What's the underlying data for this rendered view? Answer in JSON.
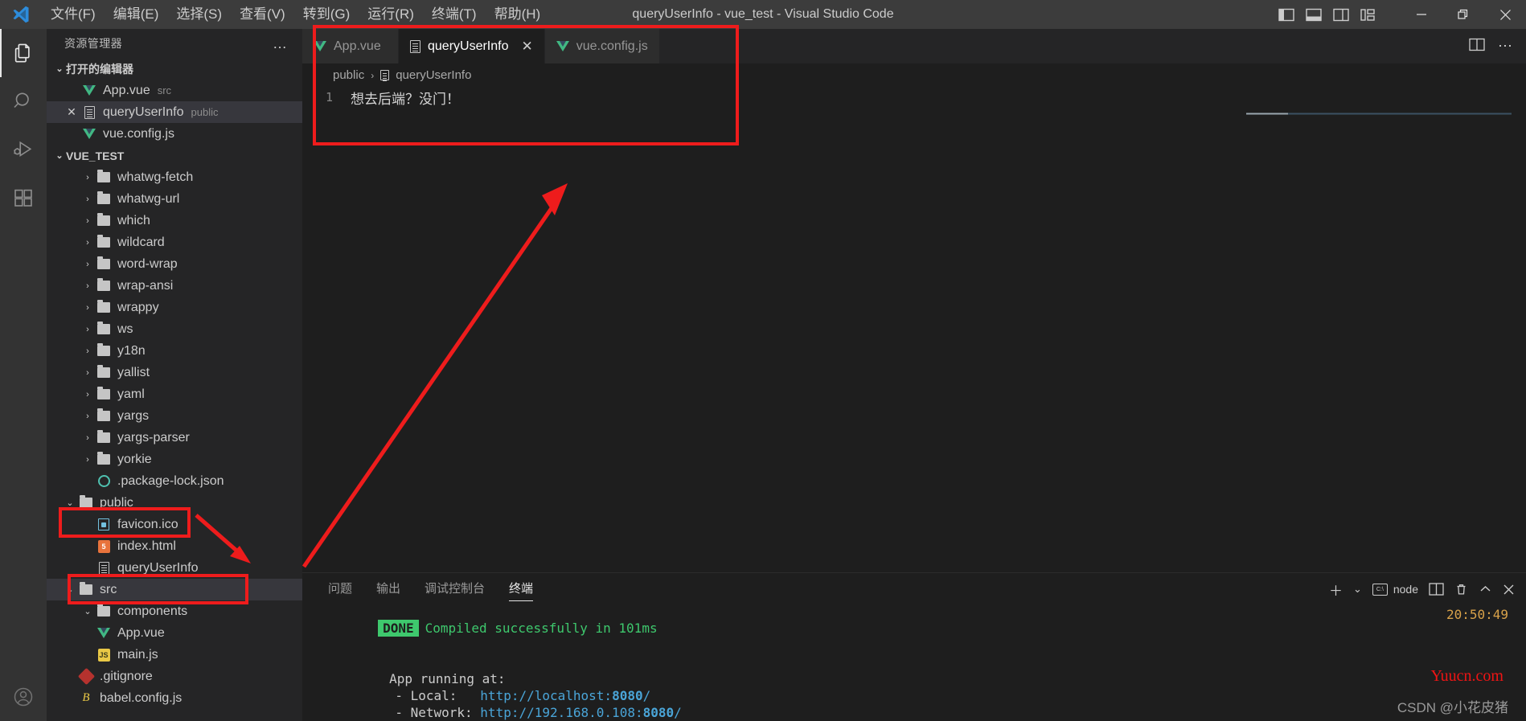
{
  "window": {
    "title": "queryUserInfo - vue_test - Visual Studio Code",
    "menus": [
      "文件(F)",
      "编辑(E)",
      "选择(S)",
      "查看(V)",
      "转到(G)",
      "运行(R)",
      "终端(T)",
      "帮助(H)"
    ],
    "layout_icons": [
      "toggle-primary-sidebar-icon",
      "toggle-panel-icon",
      "toggle-secondary-sidebar-icon",
      "customize-layout-icon"
    ],
    "win_buttons": {
      "minimize": "—",
      "restore": "❐",
      "close": "✕"
    }
  },
  "activitybar": {
    "items": [
      {
        "name": "explorer",
        "icon": "files-icon",
        "active": true
      },
      {
        "name": "search",
        "icon": "search-icon",
        "active": false
      },
      {
        "name": "run-and-debug",
        "icon": "run-debug-icon",
        "active": false
      },
      {
        "name": "extensions",
        "icon": "extensions-icon",
        "active": false
      }
    ],
    "bottom": [
      {
        "name": "accounts",
        "icon": "account-icon"
      }
    ]
  },
  "sidebar": {
    "header": "资源管理器",
    "more_label": "…",
    "open_editors": {
      "label": "打开的编辑器",
      "expanded": true,
      "items": [
        {
          "name": "App.vue",
          "desc": "src",
          "icon": "vue-icon",
          "selected": false,
          "has_close": false
        },
        {
          "name": "queryUserInfo",
          "desc": "public",
          "icon": "file-icon",
          "selected": true,
          "has_close": true
        },
        {
          "name": "vue.config.js",
          "desc": "",
          "icon": "vue-icon",
          "selected": false,
          "has_close": false
        }
      ]
    },
    "project": {
      "label": "VUE_TEST",
      "expanded": true,
      "items": [
        {
          "name": "whatwg-fetch",
          "type": "folder",
          "indent": 1,
          "expanded": false
        },
        {
          "name": "whatwg-url",
          "type": "folder",
          "indent": 1,
          "expanded": false
        },
        {
          "name": "which",
          "type": "folder",
          "indent": 1,
          "expanded": false
        },
        {
          "name": "wildcard",
          "type": "folder",
          "indent": 1,
          "expanded": false
        },
        {
          "name": "word-wrap",
          "type": "folder",
          "indent": 1,
          "expanded": false
        },
        {
          "name": "wrap-ansi",
          "type": "folder",
          "indent": 1,
          "expanded": false
        },
        {
          "name": "wrappy",
          "type": "folder",
          "indent": 1,
          "expanded": false
        },
        {
          "name": "ws",
          "type": "folder",
          "indent": 1,
          "expanded": false
        },
        {
          "name": "y18n",
          "type": "folder",
          "indent": 1,
          "expanded": false
        },
        {
          "name": "yallist",
          "type": "folder",
          "indent": 1,
          "expanded": false
        },
        {
          "name": "yaml",
          "type": "folder",
          "indent": 1,
          "expanded": false
        },
        {
          "name": "yargs",
          "type": "folder",
          "indent": 1,
          "expanded": false
        },
        {
          "name": "yargs-parser",
          "type": "folder",
          "indent": 1,
          "expanded": false
        },
        {
          "name": "yorkie",
          "type": "folder",
          "indent": 1,
          "expanded": false
        },
        {
          "name": ".package-lock.json",
          "type": "json",
          "indent": 1
        },
        {
          "name": "public",
          "type": "folder",
          "indent": 0,
          "expanded": true,
          "highlight": true
        },
        {
          "name": "favicon.ico",
          "type": "favicon",
          "indent": 1
        },
        {
          "name": "index.html",
          "type": "html",
          "indent": 1
        },
        {
          "name": "queryUserInfo",
          "type": "file",
          "indent": 1,
          "highlight": true
        },
        {
          "name": "src",
          "type": "folder",
          "indent": 0,
          "expanded": true,
          "selected": true
        },
        {
          "name": "components",
          "type": "folder",
          "indent": 1,
          "expanded": true
        },
        {
          "name": "App.vue",
          "type": "vue",
          "indent": 1
        },
        {
          "name": "main.js",
          "type": "js",
          "indent": 1
        },
        {
          "name": ".gitignore",
          "type": "gitignore",
          "indent": 0
        },
        {
          "name": "babel.config.js",
          "type": "babel",
          "indent": 0
        }
      ]
    }
  },
  "editor": {
    "tabs": [
      {
        "label": "App.vue",
        "icon": "vue-icon",
        "active": false,
        "closable": false
      },
      {
        "label": "queryUserInfo",
        "icon": "file-icon",
        "active": true,
        "closable": true
      },
      {
        "label": "vue.config.js",
        "icon": "vue-icon",
        "active": false,
        "closable": false
      }
    ],
    "tab_close_glyph": "✕",
    "actions": [
      {
        "name": "split-editor-icon",
        "glyph": "▥"
      },
      {
        "name": "more-actions-icon",
        "glyph": "⋯"
      }
    ],
    "breadcrumb": {
      "folder": "public",
      "separator": "›",
      "file": "queryUserInfo"
    },
    "lines": [
      {
        "no": "1",
        "text": "想去后端？没门！"
      }
    ]
  },
  "panel": {
    "tabs": [
      "问题",
      "输出",
      "调试控制台",
      "终端"
    ],
    "active_tab": "终端",
    "actions": {
      "new_terminal": "＋",
      "new_terminal_dropdown": "⌄",
      "shell_label": "node",
      "shell_icon": "terminal-shell-icon",
      "split_terminal": "split-terminal-icon",
      "kill_terminal": "trash-icon",
      "maximize_panel": "chevron-up-icon",
      "close_panel": "close-icon"
    },
    "timestamp": "20:50:49",
    "terminal": {
      "badge": "DONE",
      "badge_text": "Compiled successfully in 101ms",
      "running_label": "App running at:",
      "local_label": "  - Local:   ",
      "local_url_prefix": "http://localhost:",
      "local_port": "8080",
      "local_url_suffix": "/",
      "network_label": "  - Network: ",
      "network_url_prefix": "http://192.168.0.108:",
      "network_port": "8080",
      "network_url_suffix": "/"
    }
  },
  "annotations": {
    "accent_red": "#ee1c1c",
    "boxes": [
      "editor-top-region",
      "public-folder-row",
      "queryUserInfo-file-row"
    ],
    "arrows": [
      "public-to-file-arrow",
      "file-to-editor-arrow"
    ]
  },
  "watermarks": {
    "site": "Yuucn.com",
    "author": "CSDN @小花皮猪"
  }
}
